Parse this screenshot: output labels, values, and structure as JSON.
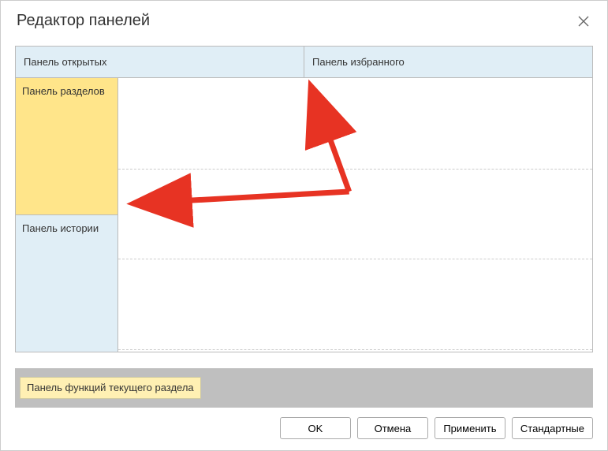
{
  "title": "Редактор панелей",
  "top_panels": {
    "open": "Панель открытых",
    "favorites": "Панель избранного"
  },
  "left_panels": {
    "sections": "Панель разделов",
    "history": "Панель истории"
  },
  "bottom_panel": {
    "current_section_functions": "Панель функций текущего раздела"
  },
  "buttons": {
    "ok": "OK",
    "cancel": "Отмена",
    "apply": "Применить",
    "default": "Стандартные"
  },
  "colors": {
    "light_blue": "#e0eef6",
    "yellow": "#ffe58a",
    "light_yellow": "#fff0b3",
    "gray_bar": "#bfbfbf",
    "arrow": "#e73323"
  }
}
